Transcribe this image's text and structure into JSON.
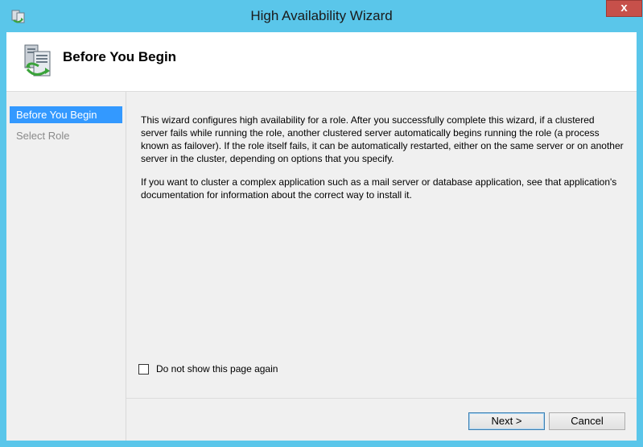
{
  "window": {
    "title": "High Availability Wizard",
    "close_label": "x"
  },
  "header": {
    "title": "Before You Begin"
  },
  "nav": {
    "items": [
      {
        "label": "Before You Begin",
        "state": "active"
      },
      {
        "label": "Select Role",
        "state": "disabled"
      }
    ]
  },
  "content": {
    "paragraphs": [
      "This wizard configures high availability for a role. After you successfully complete this wizard, if a clustered server fails while running the role, another clustered server automatically begins running the role (a process known as failover). If the role itself fails, it can be automatically restarted, either on the same server or on another server in the cluster, depending on options that you specify.",
      "If you want to cluster a complex application such as a mail server or database application, see that application's documentation for information about the correct way to install it."
    ],
    "checkbox_label": "Do not show this page again",
    "checkbox_checked": false
  },
  "buttons": {
    "next": "Next >",
    "cancel": "Cancel"
  },
  "icons": {
    "app": "cluster-wizard-icon",
    "header": "cluster-server-icon",
    "close": "close-icon"
  },
  "colors": {
    "titlebar": "#5ac6ea",
    "close": "#c7504a",
    "nav_active": "#3399ff"
  }
}
